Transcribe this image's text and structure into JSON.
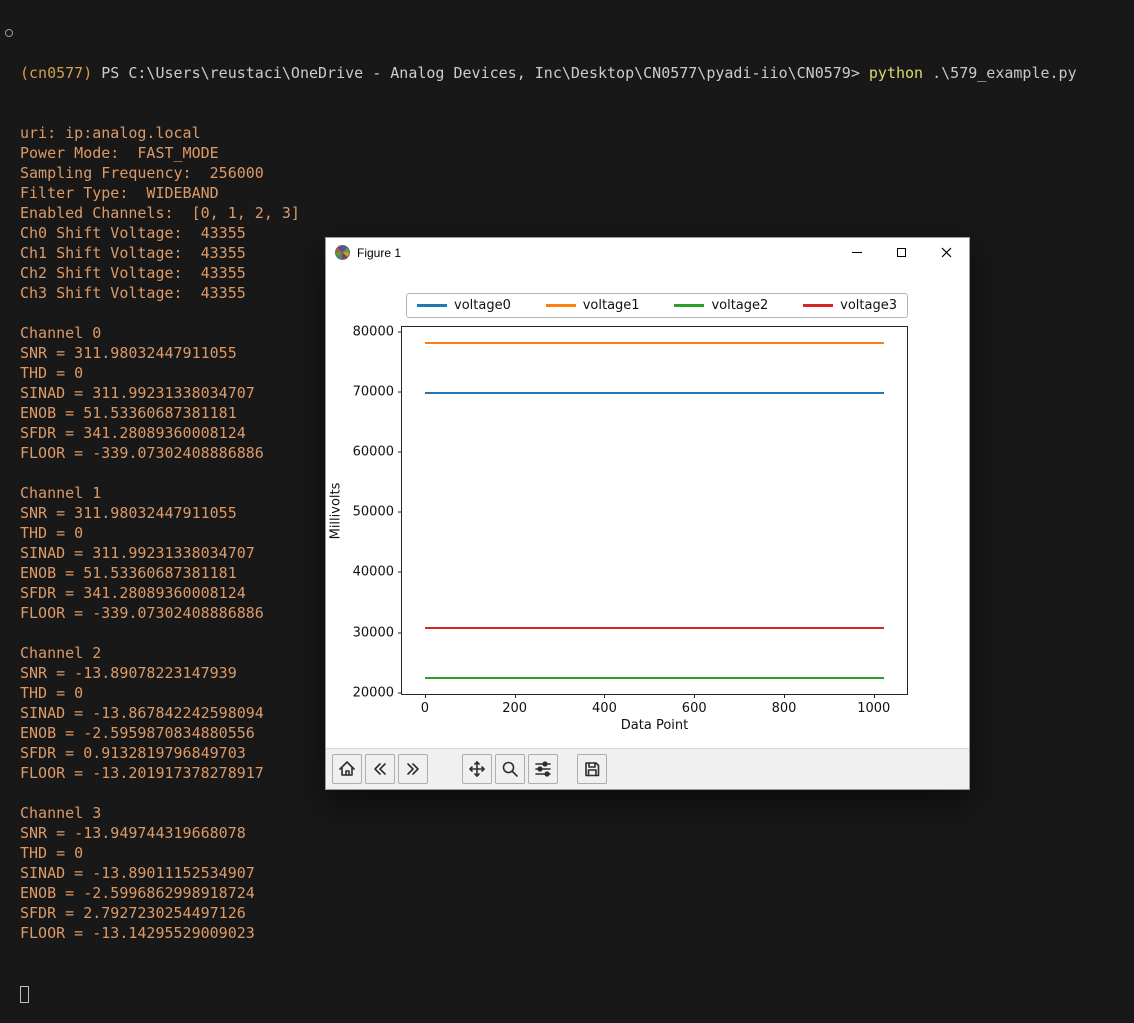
{
  "terminal": {
    "colors": {
      "background": "#181818",
      "output_text": "#dd9a66",
      "prompt_env": "#d1a04e",
      "prompt_path": "#cccccc",
      "command": "#dcdc6e"
    },
    "prompt": {
      "env": "(cn0577)",
      "path": " PS C:\\Users\\reustaci\\OneDrive - Analog Devices, Inc\\Desktop\\CN0577\\pyadi-iio\\CN0579>",
      "command": " python",
      "args": " .\\579_example.py"
    },
    "output_lines": [
      "uri: ip:analog.local",
      "Power Mode:  FAST_MODE",
      "Sampling Frequency:  256000",
      "Filter Type:  WIDEBAND",
      "Enabled Channels:  [0, 1, 2, 3]",
      "Ch0 Shift Voltage:  43355",
      "Ch1 Shift Voltage:  43355",
      "Ch2 Shift Voltage:  43355",
      "Ch3 Shift Voltage:  43355",
      "",
      "Channel 0",
      "SNR = 311.98032447911055",
      "THD = 0",
      "SINAD = 311.99231338034707",
      "ENOB = 51.53360687381181",
      "SFDR = 341.28089360008124",
      "FLOOR = -339.07302408886886",
      "",
      "Channel 1",
      "SNR = 311.98032447911055",
      "THD = 0",
      "SINAD = 311.99231338034707",
      "ENOB = 51.53360687381181",
      "SFDR = 341.28089360008124",
      "FLOOR = -339.07302408886886",
      "",
      "Channel 2",
      "SNR = -13.89078223147939",
      "THD = 0",
      "SINAD = -13.867842242598094",
      "ENOB = -2.5959870834880556",
      "SFDR = 0.9132819796849703",
      "FLOOR = -13.201917378278917",
      "",
      "Channel 3",
      "SNR = -13.949744319668078",
      "THD = 0",
      "SINAD = -13.89011152534907",
      "ENOB = -2.5996862998918724",
      "SFDR = 2.7927230254497126",
      "FLOOR = -13.14295529009023"
    ]
  },
  "figure_window": {
    "title": "Figure 1",
    "controls": [
      "minimize",
      "maximize",
      "close"
    ],
    "toolbar_buttons": [
      "home",
      "back",
      "forward",
      "pan",
      "zoom",
      "configure-subplots",
      "save"
    ]
  },
  "chart_data": {
    "type": "line",
    "title": "",
    "xlabel": "Data Point",
    "ylabel": "Millivolts",
    "xlim": [
      -51,
      1074
    ],
    "ylim": [
      19800,
      80800
    ],
    "xticks": [
      0,
      200,
      400,
      600,
      800,
      1000
    ],
    "yticks": [
      20000,
      30000,
      40000,
      50000,
      60000,
      70000,
      80000
    ],
    "x_range": [
      0,
      1023
    ],
    "grid": false,
    "legend_position": "top, outside axes, horizontal",
    "series": [
      {
        "name": "voltage0",
        "color": "#1f77b4",
        "value": 69900
      },
      {
        "name": "voltage1",
        "color": "#ff7f0e",
        "value": 78100
      },
      {
        "name": "voltage2",
        "color": "#2ca02c",
        "value": 22400
      },
      {
        "name": "voltage3",
        "color": "#d62728",
        "value": 30800
      }
    ]
  }
}
